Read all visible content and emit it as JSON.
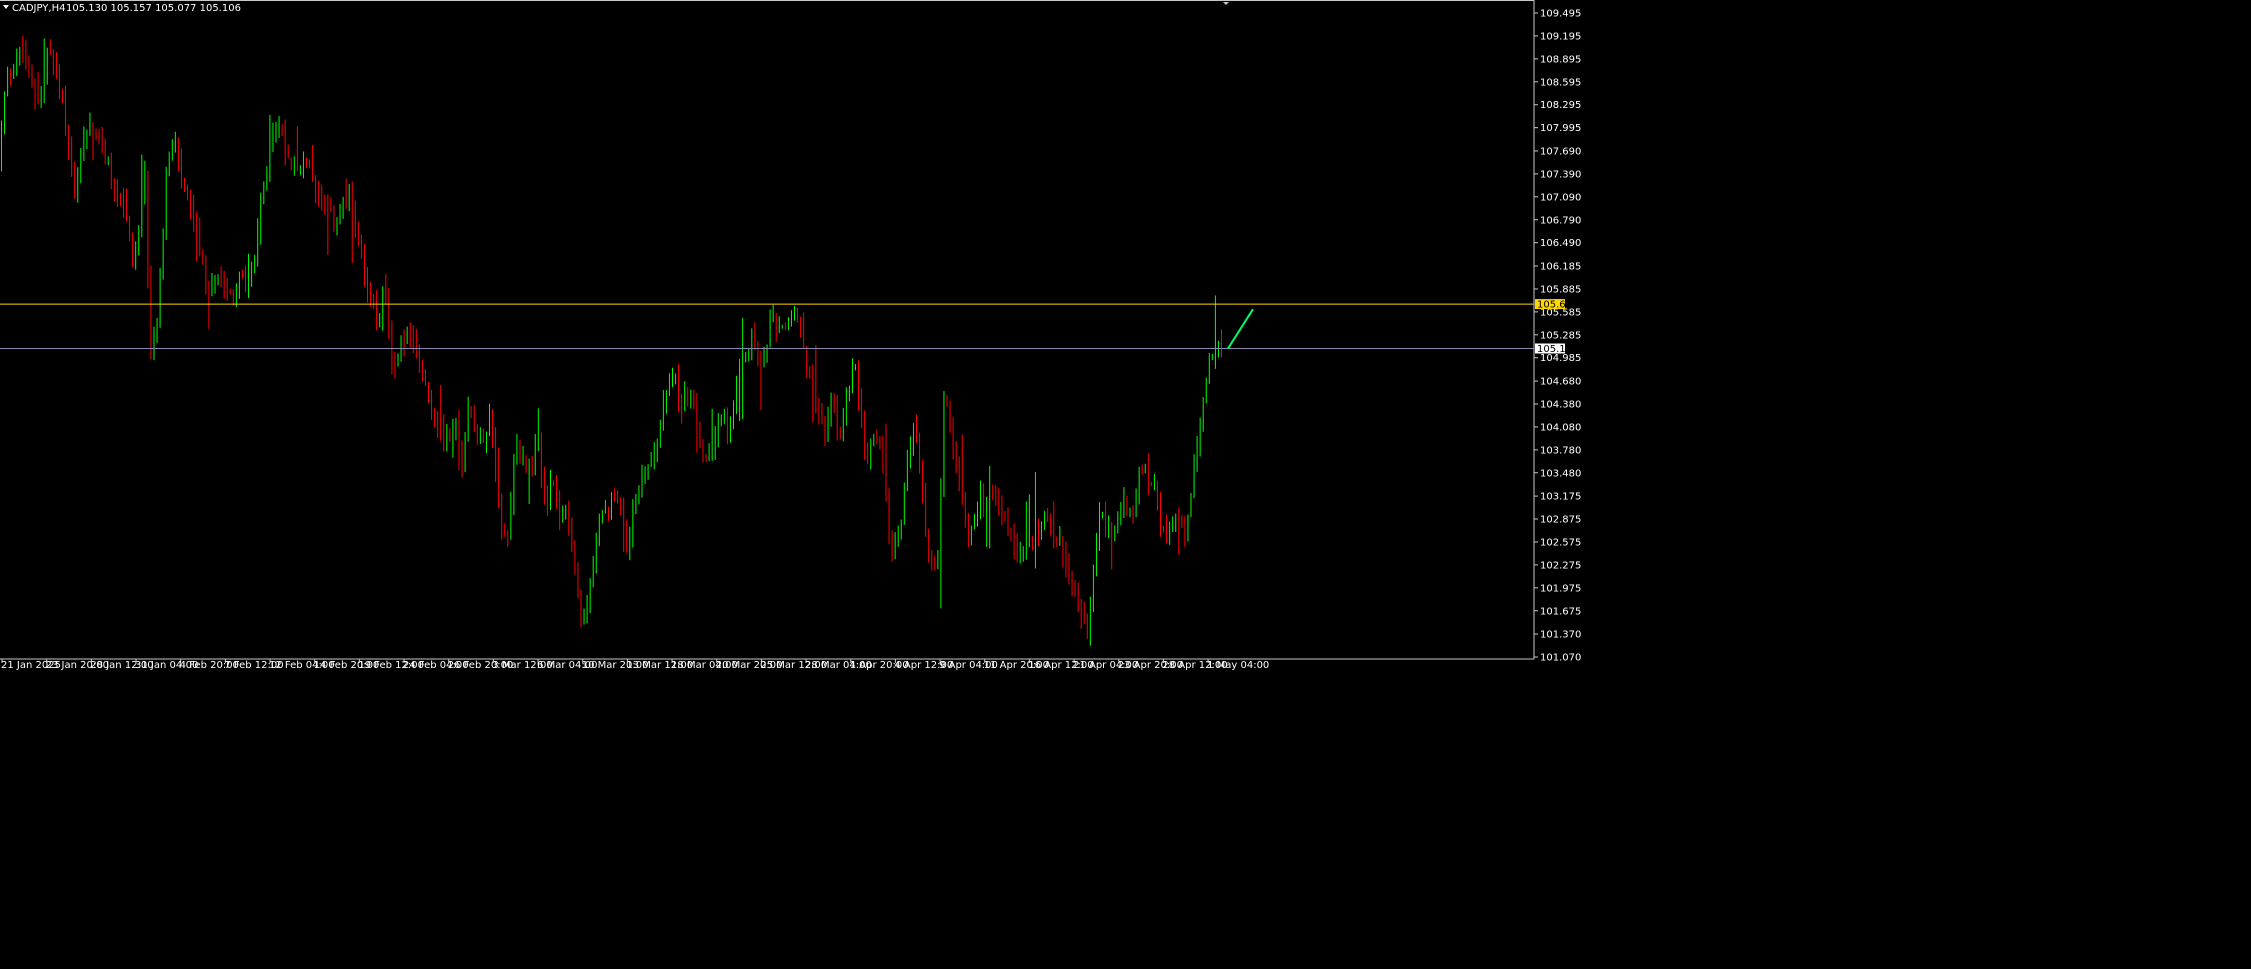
{
  "header": {
    "symbol": "CADJPY,H4",
    "ohlc": "105.130 105.157 105.077 105.106"
  },
  "colors": {
    "background": "#000000",
    "bull": "#00ff00",
    "bear": "#ff0000",
    "axis": "#c8c8c8",
    "resistance_line": "#ffd700",
    "bid_line": "#8a8ab0",
    "arrow": "#00ff66"
  },
  "chart_data": {
    "type": "candlestick",
    "title": "CADJPY,H4",
    "grid": false,
    "ylim": [
      101.07,
      109.495
    ],
    "y_ticks": [
      "109.495",
      "109.195",
      "108.895",
      "108.595",
      "108.295",
      "107.995",
      "107.690",
      "107.390",
      "107.090",
      "106.790",
      "106.490",
      "106.185",
      "105.885",
      "105.585",
      "105.285",
      "104.985",
      "104.680",
      "104.380",
      "104.080",
      "103.780",
      "103.480",
      "103.175",
      "102.875",
      "102.575",
      "102.275",
      "101.975",
      "101.675",
      "101.370",
      "101.070"
    ],
    "x_ticks": [
      "21 Jan 2025",
      "23 Jan 20:00",
      "28 Jan 12:00",
      "31 Jan 04:00",
      "4 Feb 20:00",
      "7 Feb 12:00",
      "12 Feb 04:00",
      "14 Feb 20:00",
      "19 Feb 12:00",
      "24 Feb 04:00",
      "26 Feb 20:00",
      "3 Mar 12:00",
      "6 Mar 04:00",
      "10 Mar 20:00",
      "13 Mar 12:00",
      "18 Mar 04:00",
      "20 Mar 20:00",
      "25 Mar 12:00",
      "28 Mar 04:00",
      "1 Apr 20:00",
      "4 Apr 12:00",
      "9 Apr 04:00",
      "11 Apr 20:00",
      "16 Apr 12:00",
      "21 Apr 04:00",
      "23 Apr 20:00",
      "28 Apr 12:00",
      "1 May 04:00"
    ],
    "horizontal_lines": [
      {
        "name": "resistance",
        "value": 105.687,
        "label": "105.687"
      },
      {
        "name": "bid",
        "value": 105.106,
        "label": "105.106"
      }
    ],
    "price_path": [
      [
        0,
        107.6
      ],
      [
        8,
        108.65
      ],
      [
        16,
        108.85
      ],
      [
        24,
        109.0
      ],
      [
        34,
        108.5
      ],
      [
        42,
        108.4
      ],
      [
        50,
        109.05
      ],
      [
        58,
        108.6
      ],
      [
        66,
        108.2
      ],
      [
        72,
        107.5
      ],
      [
        78,
        107.2
      ],
      [
        84,
        107.9
      ],
      [
        92,
        108.05
      ],
      [
        100,
        107.8
      ],
      [
        108,
        107.55
      ],
      [
        118,
        107.1
      ],
      [
        126,
        106.95
      ],
      [
        134,
        106.2
      ],
      [
        140,
        106.5
      ],
      [
        146,
        107.5
      ],
      [
        152,
        105.1
      ],
      [
        158,
        105.45
      ],
      [
        164,
        106.6
      ],
      [
        168,
        107.4
      ],
      [
        176,
        107.8
      ],
      [
        182,
        107.35
      ],
      [
        188,
        107.0
      ],
      [
        194,
        106.8
      ],
      [
        200,
        106.3
      ],
      [
        210,
        105.85
      ],
      [
        218,
        106.1
      ],
      [
        226,
        106.0
      ],
      [
        234,
        105.75
      ],
      [
        242,
        106.05
      ],
      [
        250,
        105.9
      ],
      [
        258,
        106.4
      ],
      [
        264,
        107.2
      ],
      [
        270,
        107.5
      ],
      [
        276,
        108.1
      ],
      [
        282,
        107.95
      ],
      [
        290,
        107.6
      ],
      [
        298,
        107.55
      ],
      [
        306,
        107.5
      ],
      [
        314,
        107.35
      ],
      [
        322,
        107.0
      ],
      [
        330,
        106.85
      ],
      [
        336,
        106.75
      ],
      [
        342,
        106.95
      ],
      [
        350,
        107.05
      ],
      [
        356,
        106.85
      ],
      [
        362,
        106.45
      ],
      [
        368,
        105.85
      ],
      [
        374,
        105.75
      ],
      [
        380,
        105.35
      ],
      [
        386,
        106.0
      ],
      [
        392,
        105.1
      ],
      [
        396,
        104.85
      ],
      [
        402,
        105.15
      ],
      [
        410,
        105.3
      ],
      [
        418,
        105.0
      ],
      [
        426,
        104.75
      ],
      [
        434,
        104.3
      ],
      [
        442,
        104.0
      ],
      [
        450,
        103.95
      ],
      [
        458,
        104.1
      ],
      [
        464,
        103.55
      ],
      [
        470,
        104.4
      ],
      [
        478,
        104.05
      ],
      [
        486,
        103.9
      ],
      [
        492,
        104.25
      ],
      [
        498,
        103.5
      ],
      [
        504,
        102.75
      ],
      [
        510,
        102.6
      ],
      [
        516,
        103.8
      ],
      [
        524,
        103.75
      ],
      [
        532,
        103.5
      ],
      [
        540,
        103.85
      ],
      [
        548,
        103.0
      ],
      [
        554,
        103.4
      ],
      [
        560,
        102.9
      ],
      [
        566,
        103.0
      ],
      [
        572,
        102.65
      ],
      [
        578,
        101.95
      ],
      [
        584,
        101.65
      ],
      [
        590,
        101.85
      ],
      [
        596,
        102.4
      ],
      [
        602,
        102.85
      ],
      [
        610,
        103.0
      ],
      [
        618,
        103.15
      ],
      [
        624,
        103.05
      ],
      [
        630,
        102.35
      ],
      [
        636,
        103.2
      ],
      [
        642,
        103.25
      ],
      [
        648,
        103.55
      ],
      [
        656,
        103.75
      ],
      [
        662,
        104.1
      ],
      [
        668,
        104.55
      ],
      [
        676,
        104.7
      ],
      [
        682,
        104.35
      ],
      [
        688,
        104.6
      ],
      [
        694,
        104.5
      ],
      [
        700,
        103.9
      ],
      [
        706,
        103.55
      ],
      [
        712,
        103.8
      ],
      [
        718,
        104.05
      ],
      [
        724,
        104.2
      ],
      [
        730,
        104.05
      ],
      [
        736,
        104.25
      ],
      [
        742,
        104.7
      ],
      [
        748,
        105.1
      ],
      [
        756,
        105.2
      ],
      [
        764,
        104.85
      ],
      [
        770,
        105.35
      ],
      [
        776,
        105.45
      ],
      [
        782,
        105.25
      ],
      [
        790,
        105.45
      ],
      [
        796,
        105.6
      ],
      [
        802,
        105.35
      ],
      [
        808,
        104.95
      ],
      [
        814,
        104.6
      ],
      [
        820,
        104.3
      ],
      [
        826,
        104.05
      ],
      [
        834,
        104.35
      ],
      [
        842,
        104.0
      ],
      [
        848,
        104.5
      ],
      [
        856,
        104.85
      ],
      [
        862,
        104.2
      ],
      [
        868,
        103.6
      ],
      [
        874,
        103.85
      ],
      [
        880,
        103.95
      ],
      [
        886,
        103.45
      ],
      [
        892,
        102.45
      ],
      [
        898,
        102.6
      ],
      [
        904,
        102.95
      ],
      [
        910,
        103.8
      ],
      [
        916,
        104.1
      ],
      [
        922,
        103.4
      ],
      [
        928,
        102.65
      ],
      [
        934,
        102.3
      ],
      [
        940,
        102.35
      ],
      [
        946,
        104.55
      ],
      [
        952,
        104.1
      ],
      [
        958,
        103.45
      ],
      [
        964,
        103.2
      ],
      [
        970,
        102.55
      ],
      [
        976,
        102.85
      ],
      [
        982,
        103.25
      ],
      [
        988,
        103.0
      ],
      [
        994,
        103.3
      ],
      [
        1000,
        103.1
      ],
      [
        1006,
        102.85
      ],
      [
        1012,
        102.65
      ],
      [
        1018,
        102.35
      ],
      [
        1024,
        102.45
      ],
      [
        1030,
        102.55
      ],
      [
        1036,
        102.7
      ],
      [
        1042,
        102.75
      ],
      [
        1048,
        102.9
      ],
      [
        1054,
        102.7
      ],
      [
        1060,
        102.65
      ],
      [
        1066,
        102.25
      ],
      [
        1072,
        101.95
      ],
      [
        1078,
        101.75
      ],
      [
        1084,
        101.6
      ],
      [
        1090,
        101.4
      ],
      [
        1096,
        102.35
      ],
      [
        1102,
        102.95
      ],
      [
        1108,
        102.8
      ],
      [
        1114,
        102.6
      ],
      [
        1120,
        102.95
      ],
      [
        1126,
        103.1
      ],
      [
        1132,
        102.85
      ],
      [
        1138,
        103.3
      ],
      [
        1144,
        103.65
      ],
      [
        1150,
        103.4
      ],
      [
        1156,
        103.45
      ],
      [
        1162,
        102.7
      ],
      [
        1168,
        102.65
      ],
      [
        1174,
        102.75
      ],
      [
        1180,
        102.9
      ],
      [
        1186,
        102.65
      ],
      [
        1192,
        103.2
      ],
      [
        1198,
        103.8
      ],
      [
        1204,
        104.35
      ],
      [
        1210,
        104.85
      ],
      [
        1216,
        105.1
      ],
      [
        1222,
        105.106
      ]
    ],
    "arrow": {
      "from": [
        1228,
        105.106
      ],
      "to": [
        1253,
        105.62
      ]
    }
  }
}
